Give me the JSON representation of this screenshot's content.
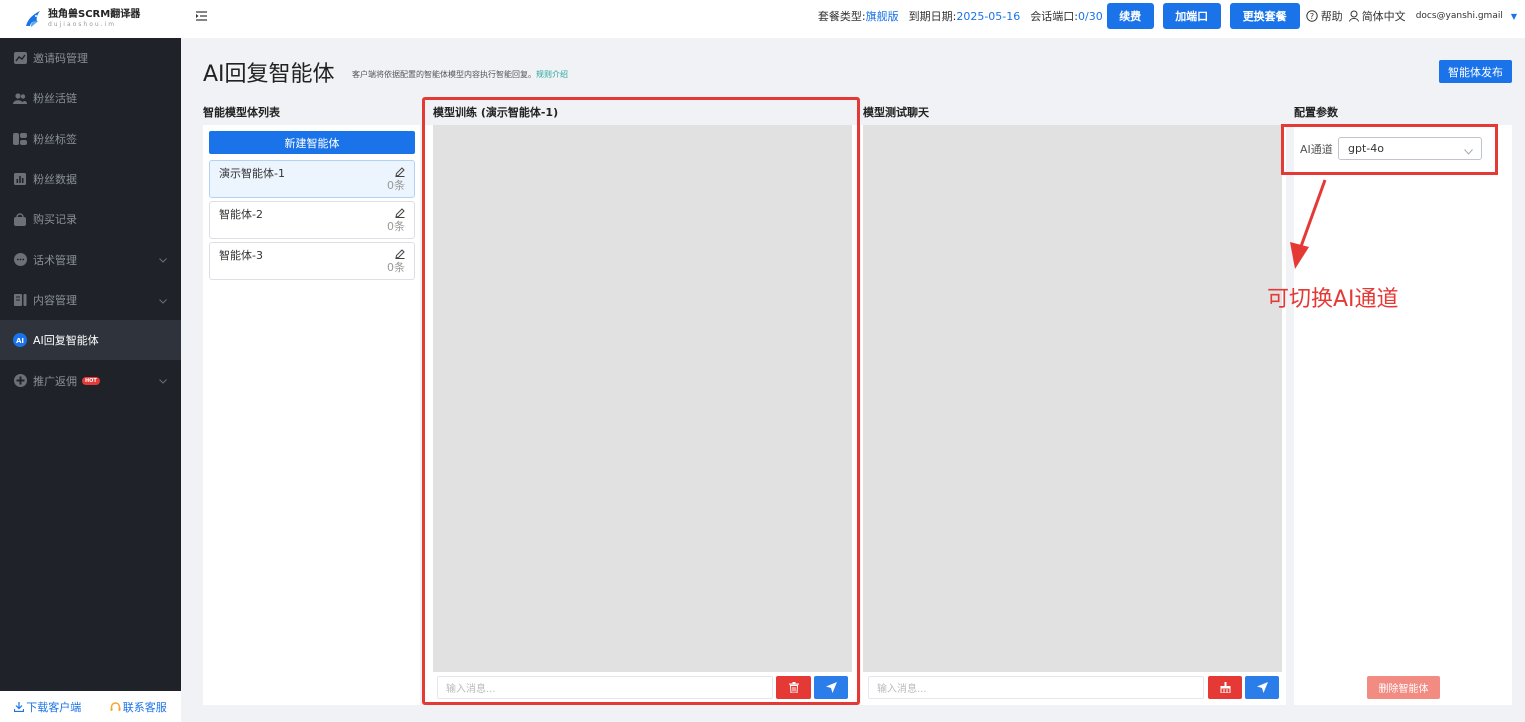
{
  "brand": {
    "title": "独角兽SCRM翻译器",
    "subtitle": "dujiaoshou.im"
  },
  "sidebar": {
    "items": [
      {
        "label": "邀请码管理",
        "icon": "chart-icon"
      },
      {
        "label": "粉丝活链",
        "icon": "users-icon"
      },
      {
        "label": "粉丝标签",
        "icon": "tag-icon"
      },
      {
        "label": "粉丝数据",
        "icon": "bar-chart-icon"
      },
      {
        "label": "购买记录",
        "icon": "bag-icon"
      },
      {
        "label": "话术管理",
        "icon": "chat-icon"
      },
      {
        "label": "内容管理",
        "icon": "document-icon"
      },
      {
        "label": "AI回复智能体",
        "icon": "ai-icon"
      },
      {
        "label": "推广返佣",
        "icon": "plus-circle-icon",
        "badge": "HOT"
      }
    ],
    "footer": {
      "download": "下载客户端",
      "contact": "联系客服"
    }
  },
  "header": {
    "plan_label": "套餐类型:",
    "plan_value": "旗舰版",
    "expire_label": "到期日期:",
    "expire_value": "2025-05-16",
    "port_label": "会话端口:",
    "port_value": "0/30",
    "renew": "续费",
    "add_port": "加端口",
    "change_plan": "更换套餐",
    "help": "帮助",
    "language": "简体中文",
    "email": "docs@yanshi.gmail"
  },
  "page": {
    "title": "AI回复智能体",
    "desc": "客户端将依据配置的智能体模型内容执行智能回复。",
    "rule_link": "规则介绍",
    "publish": "智能体发布"
  },
  "list": {
    "title": "智能模型体列表",
    "new_button": "新建智能体",
    "agents": [
      {
        "name": "演示智能体-1",
        "count": "0条"
      },
      {
        "name": "智能体-2",
        "count": "0条"
      },
      {
        "name": "智能体-3",
        "count": "0条"
      }
    ]
  },
  "training": {
    "title": "模型训练 (演示智能体-1)",
    "placeholder": "输入消息..."
  },
  "test": {
    "title": "模型测试聊天",
    "placeholder": "输入消息..."
  },
  "config": {
    "title": "配置参数",
    "channel_label": "AI通道",
    "channel_value": "gpt-4o",
    "delete_button": "删除智能体"
  },
  "annotation": {
    "text": "可切换AI通道"
  },
  "colors": {
    "accent": "#1a73e8",
    "danger": "#e53935",
    "sidebar": "#1f2329"
  }
}
